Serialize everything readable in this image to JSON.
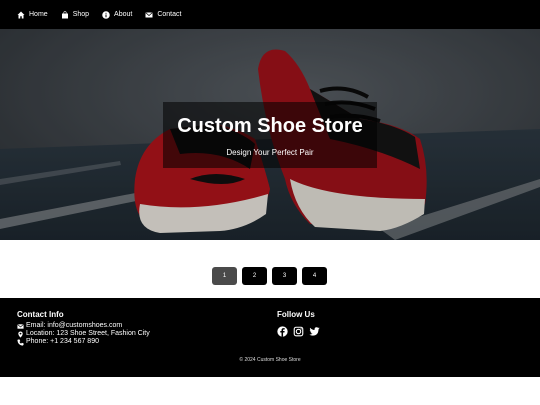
{
  "nav": {
    "items": [
      {
        "label": "Home",
        "icon": "home-icon"
      },
      {
        "label": "Shop",
        "icon": "shopping-bag-icon"
      },
      {
        "label": "About",
        "icon": "info-icon"
      },
      {
        "label": "Contact",
        "icon": "envelope-icon"
      }
    ]
  },
  "hero": {
    "title": "Custom Shoe Store",
    "subtitle": "Design Your Perfect Pair"
  },
  "pagination": {
    "pages": [
      "1",
      "2",
      "3",
      "4"
    ],
    "current": "1"
  },
  "footer": {
    "contact_heading": "Contact Info",
    "email": "Email: info@customshoes.com",
    "location": "Location: 123 Shoe Street, Fashion City",
    "phone": "Phone: +1 234 567 890",
    "follow_heading": "Follow Us",
    "social": [
      "facebook-icon",
      "instagram-icon",
      "twitter-icon"
    ],
    "copyright": "© 2024 Custom Shoe Store"
  },
  "colors": {
    "nav_bg": "#000000",
    "footer_bg": "#000000",
    "active_page": "#4a4a4a",
    "shoe_red": "#b3141c"
  }
}
